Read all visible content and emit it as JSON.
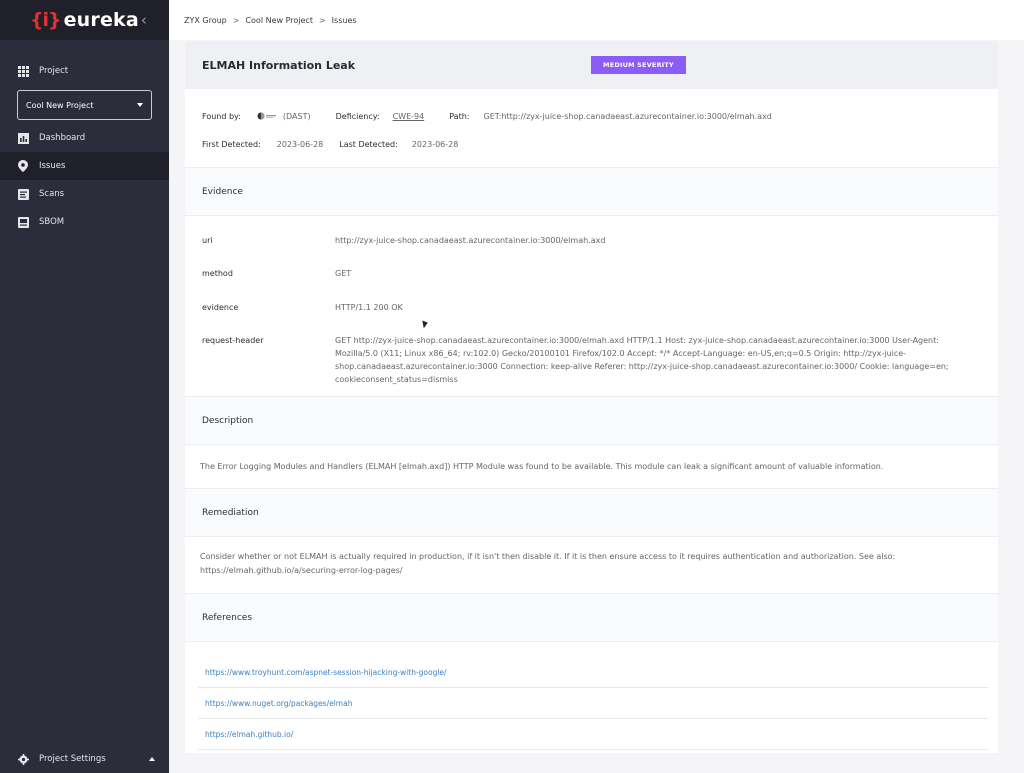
{
  "app": {
    "logo_mark": "{i}",
    "logo_text": "eureka",
    "collapse_glyph": "‹"
  },
  "sidebar": {
    "project_label": "Project",
    "project_select": "Cool New Project",
    "items": [
      {
        "label": "Dashboard",
        "icon": "chart-icon"
      },
      {
        "label": "Issues",
        "icon": "pin-icon",
        "active": true
      },
      {
        "label": "Scans",
        "icon": "scan-icon"
      },
      {
        "label": "SBOM",
        "icon": "document-icon"
      }
    ],
    "settings_label": "Project Settings"
  },
  "breadcrumb": [
    "ZYX Group",
    "Cool New Project",
    "Issues"
  ],
  "issue": {
    "title": "ELMAH Information Leak",
    "severity": "MEDIUM SEVERITY",
    "severity_color": "#8b5cf6",
    "found_by_label": "Found by:",
    "found_by_value": "(DAST)",
    "deficiency_label": "Deficiency:",
    "deficiency_value": "CWE-94",
    "path_label": "Path:",
    "path_value": "GET:http://zyx-juice-shop.canadaeast.azurecontainer.io:3000/elmah.axd",
    "first_detected_label": "First Detected:",
    "first_detected_value": "2023-06-28",
    "last_detected_label": "Last Detected:",
    "last_detected_value": "2023-06-28"
  },
  "evidence": {
    "heading": "Evidence",
    "rows": [
      {
        "key": "uri",
        "value": "http://zyx-juice-shop.canadaeast.azurecontainer.io:3000/elmah.axd"
      },
      {
        "key": "method",
        "value": "GET"
      },
      {
        "key": "evidence",
        "value": "HTTP/1.1 200 OK"
      },
      {
        "key": "request-header",
        "value": "GET http://zyx-juice-shop.canadaeast.azurecontainer.io:3000/elmah.axd HTTP/1.1 Host: zyx-juice-shop.canadaeast.azurecontainer.io:3000 User-Agent: Mozilla/5.0 (X11; Linux x86_64; rv:102.0) Gecko/20100101 Firefox/102.0 Accept: */* Accept-Language: en-US,en;q=0.5 Origin: http://zyx-juice-shop.canadaeast.azurecontainer.io:3000 Connection: keep-alive Referer: http://zyx-juice-shop.canadaeast.azurecontainer.io:3000/ Cookie: language=en; cookieconsent_status=dismiss"
      }
    ]
  },
  "description": {
    "heading": "Description",
    "text": "The Error Logging Modules and Handlers (ELMAH [elmah.axd]) HTTP Module was found to be available. This module can leak a significant amount of valuable information."
  },
  "remediation": {
    "heading": "Remediation",
    "text": "Consider whether or not ELMAH is actually required in production, if it isn't then disable it. If it is then ensure access to it requires authentication and authorization. See also: https://elmah.github.io/a/securing-error-log-pages/"
  },
  "references": {
    "heading": "References",
    "links": [
      "https://www.troyhunt.com/aspnet-session-hijacking-with-google/",
      "https://www.nuget.org/packages/elmah",
      "https://elmah.github.io/"
    ]
  }
}
